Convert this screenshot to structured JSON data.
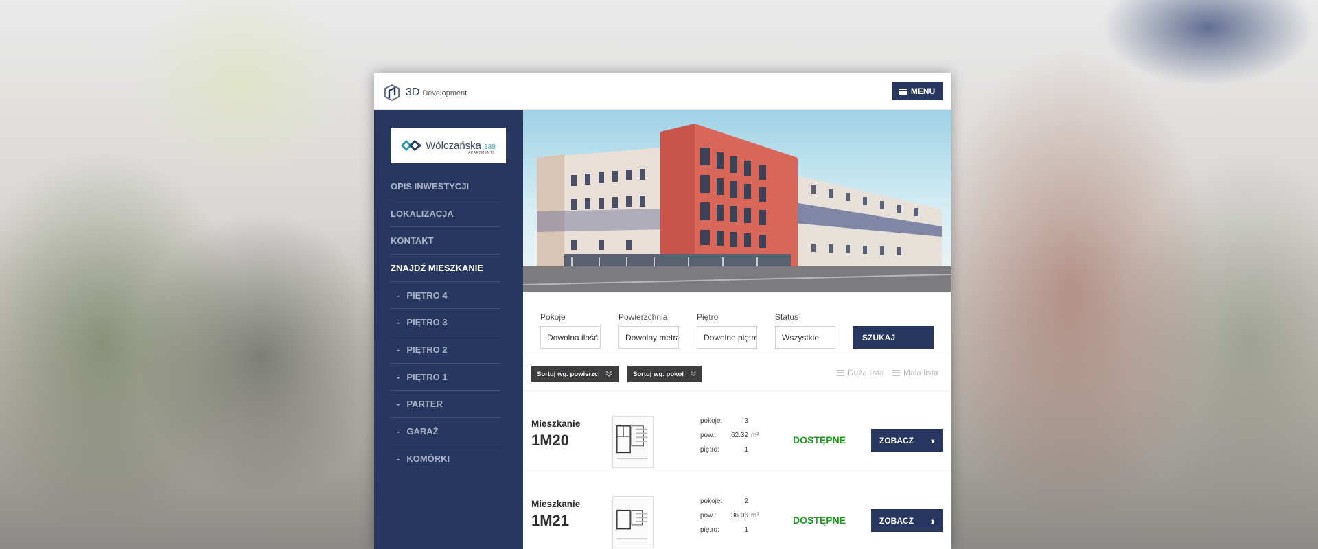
{
  "header": {
    "brand_main": "3D",
    "brand_sub": "Development",
    "menu_label": "MENU"
  },
  "sidebar": {
    "logo_name": "Wólczańska",
    "logo_number": "188",
    "logo_sub": "APARTMENTS",
    "items": [
      {
        "label": "OPIS INWESTYCJI"
      },
      {
        "label": "LOKALIZACJA"
      },
      {
        "label": "KONTAKT"
      },
      {
        "label": "ZNAJDŹ MIESZKANIE"
      },
      {
        "label": "PIĘTRO 4"
      },
      {
        "label": "PIĘTRO 3"
      },
      {
        "label": "PIĘTRO 2"
      },
      {
        "label": "PIĘTRO 1"
      },
      {
        "label": "PARTER"
      },
      {
        "label": "GARAŻ"
      },
      {
        "label": "KOMÓRKI"
      }
    ],
    "sub_dash": "-"
  },
  "filters": {
    "rooms_label": "Pokoje",
    "rooms_value": "Dowolna ilość",
    "area_label": "Powierzchnia",
    "area_value": "Dowolny metraż",
    "floor_label": "Piętro",
    "floor_value": "Dowolne piętro",
    "status_label": "Status",
    "status_value": "Wszystkie",
    "search_label": "SZUKAJ"
  },
  "sorting": {
    "sort_area": "Sortuj wg. powierzchni",
    "sort_rooms": "Sortuj wg. pokoi",
    "view_large": "Duża lista",
    "view_small": "Mała lista"
  },
  "apartments": [
    {
      "label": "Mieszkanie",
      "code": "1M20",
      "rooms_key": "pokoje:",
      "rooms": "3",
      "area_key": "pow.:",
      "area": "62.32",
      "unit": "m²",
      "floor_key": "piętro:",
      "floor": "1",
      "status": "DOSTĘPNE",
      "button": "ZOBACZ"
    },
    {
      "label": "Mieszkanie",
      "code": "1M21",
      "rooms_key": "pokoje:",
      "rooms": "2",
      "area_key": "pow.:",
      "area": "36.06",
      "unit": "m²",
      "floor_key": "piętro:",
      "floor": "1",
      "status": "DOSTĘPNE",
      "button": "ZOBACZ"
    }
  ],
  "colors": {
    "navy": "#27375f",
    "available_green": "#1e9a1e",
    "facade_red": "#d45f52"
  }
}
